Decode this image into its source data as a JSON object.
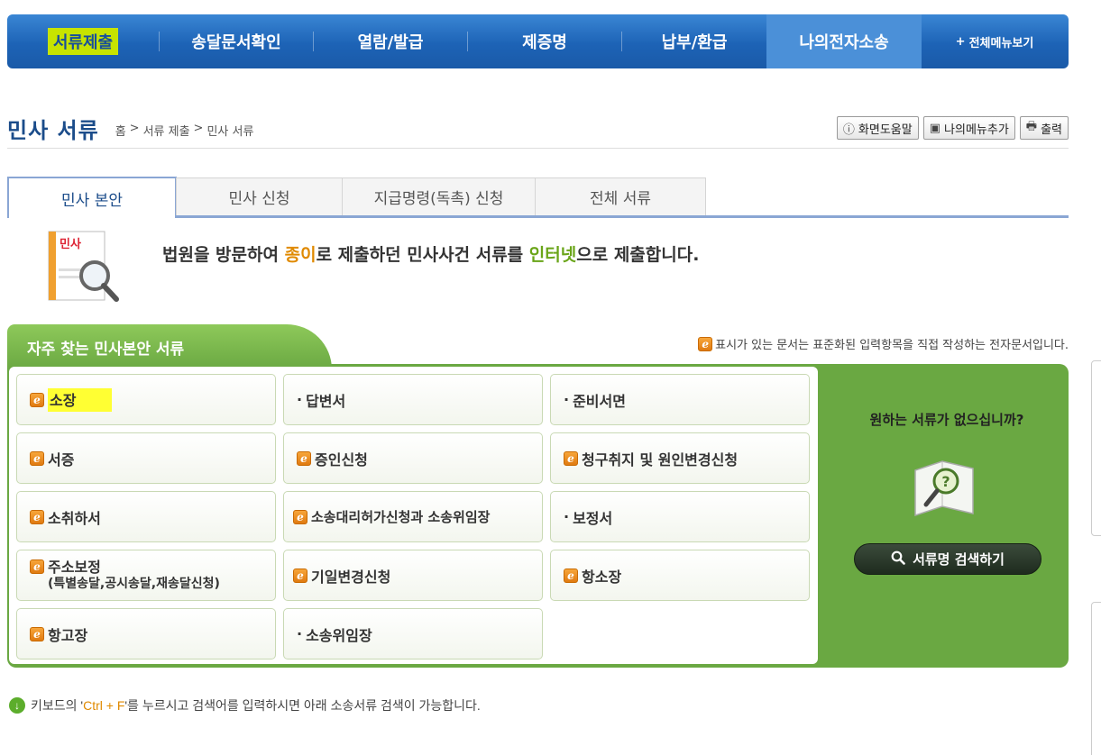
{
  "nav": {
    "items": [
      {
        "label": "서류제출"
      },
      {
        "label": "송달문서확인"
      },
      {
        "label": "열람/발급"
      },
      {
        "label": "제증명"
      },
      {
        "label": "납부/환급"
      },
      {
        "label": "나의전자소송"
      }
    ],
    "all_menu": "전체메뉴보기"
  },
  "title": {
    "text": "민사 서류",
    "breadcrumb": [
      "홈",
      ">",
      "서류 제출",
      ">",
      "민사 서류"
    ],
    "help": "화면도움말",
    "add_menu": "나의메뉴추가",
    "print": "출력"
  },
  "tabs": [
    "민사 본안",
    "민사 신청",
    "지급명령(독촉) 신청",
    "전체 서류"
  ],
  "intro": {
    "icon_label": "민사",
    "p1": "법원을 방문하여 ",
    "p2": "종이",
    "p3": "로 제출하던 민사사건 서류를 ",
    "p4": "인터넷",
    "p5": "으로 제출합니다."
  },
  "section": {
    "title": "자주 찾는 민사본안 서류",
    "note": "표시가 있는 문서는 표준화된 입력항목을 직접 작성하는 전자문서입니다."
  },
  "docs": [
    {
      "label": "소장",
      "e": true
    },
    {
      "label": "답변서",
      "e": false
    },
    {
      "label": "준비서면",
      "e": false
    },
    {
      "label": "서증",
      "e": true
    },
    {
      "label": "증인신청",
      "e": true
    },
    {
      "label": "청구취지 및 원인변경신청",
      "e": true
    },
    {
      "label": "소취하서",
      "e": true
    },
    {
      "label": "소송대리허가신청과 소송위임장",
      "e": true
    },
    {
      "label": "보정서",
      "e": false
    },
    {
      "label": "주소보정",
      "sub": "(특별송달,공시송달,재송달신청)",
      "e": true
    },
    {
      "label": "기일변경신청",
      "e": true
    },
    {
      "label": "항소장",
      "e": true
    },
    {
      "label": "항고장",
      "e": true
    },
    {
      "label": "소송위임장",
      "e": false
    }
  ],
  "side": {
    "question": "원하는 서류가 없으십니까?",
    "search_label": "서류명 검색하기"
  },
  "hint": {
    "p1": "키보드의 '",
    "p2": "Ctrl + F",
    "p3": "'를 누르시고 검색어를 입력하시면 아래 소송서류 검색이 가능합니다."
  },
  "colors": {
    "nav_blue": "#1d63b6",
    "green": "#6aa842",
    "highlight": "#ffff33",
    "accent_orange": "#e08a00"
  }
}
